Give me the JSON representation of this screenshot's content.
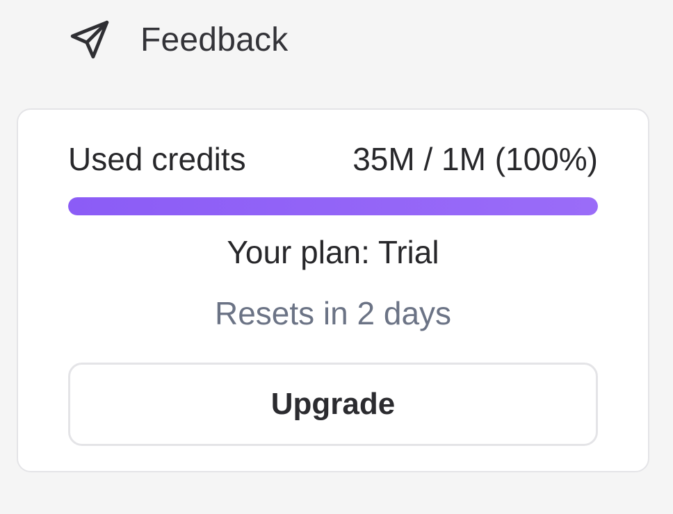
{
  "feedback": {
    "label": "Feedback",
    "icon": "send-icon"
  },
  "credits": {
    "label": "Used credits",
    "value": "35M / 1M (100%)",
    "progress_fraction": 1.0,
    "bar_color": "#8b5cf6"
  },
  "plan": {
    "text": "Your plan: Trial"
  },
  "reset": {
    "text": "Resets in 2 days"
  },
  "upgrade": {
    "label": "Upgrade"
  }
}
